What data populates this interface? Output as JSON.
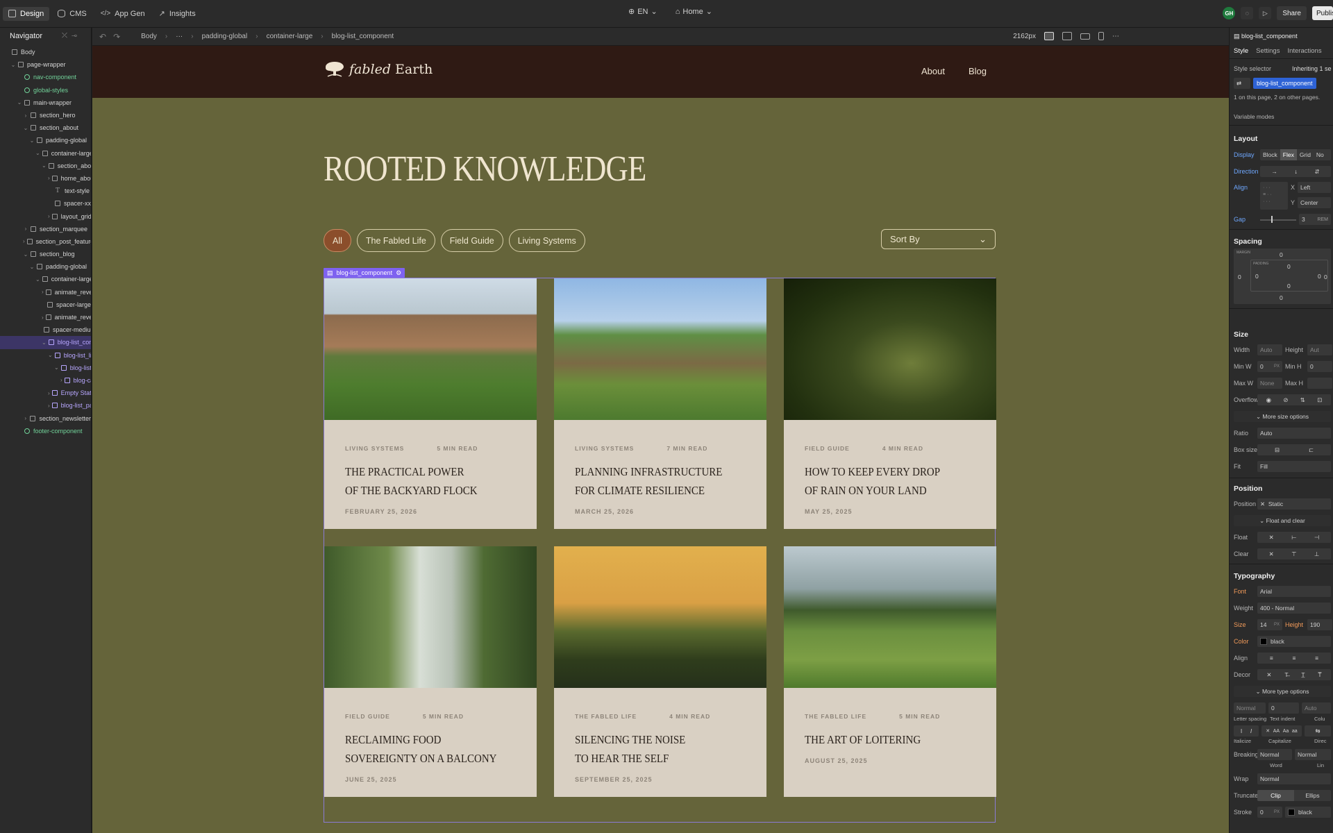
{
  "topbar": {
    "tabs": [
      {
        "label": "Design",
        "icon": "cursor-icon"
      },
      {
        "label": "CMS",
        "icon": "database-icon"
      },
      {
        "label": "App Gen",
        "icon": "code-icon"
      },
      {
        "label": "Insights",
        "icon": "chart-icon"
      }
    ],
    "locale": "EN",
    "page": "Home",
    "avatar": "GH",
    "share": "Share",
    "publish": "Publish"
  },
  "navigator": {
    "title": "Navigator",
    "nodes": [
      {
        "label": "Body",
        "depth": 0,
        "kind": "body",
        "caret": ""
      },
      {
        "label": "page-wrapper",
        "depth": 1,
        "kind": "box",
        "caret": "v"
      },
      {
        "label": "nav-component",
        "depth": 2,
        "kind": "component",
        "caret": ""
      },
      {
        "label": "global-styles",
        "depth": 2,
        "kind": "component",
        "caret": ""
      },
      {
        "label": "main-wrapper",
        "depth": 2,
        "kind": "box",
        "caret": "v"
      },
      {
        "label": "section_hero",
        "depth": 3,
        "kind": "box",
        "caret": ">"
      },
      {
        "label": "section_about",
        "depth": 3,
        "kind": "box",
        "caret": "v"
      },
      {
        "label": "padding-global",
        "depth": 4,
        "kind": "box",
        "caret": "v"
      },
      {
        "label": "container-large",
        "depth": 5,
        "kind": "box",
        "caret": "v"
      },
      {
        "label": "section_about",
        "depth": 6,
        "kind": "box",
        "caret": "v"
      },
      {
        "label": "home_about",
        "depth": 7,
        "kind": "box",
        "caret": ">"
      },
      {
        "label": "text-style",
        "depth": 7,
        "kind": "text",
        "caret": ""
      },
      {
        "label": "spacer-xx",
        "depth": 7,
        "kind": "box",
        "caret": ""
      },
      {
        "label": "layout_grid",
        "depth": 7,
        "kind": "box",
        "caret": ">"
      },
      {
        "label": "section_marquee",
        "depth": 3,
        "kind": "box",
        "caret": ">"
      },
      {
        "label": "section_post_featured",
        "depth": 3,
        "kind": "box",
        "caret": ">"
      },
      {
        "label": "section_blog",
        "depth": 3,
        "kind": "box",
        "caret": "v"
      },
      {
        "label": "padding-global",
        "depth": 4,
        "kind": "box",
        "caret": "v"
      },
      {
        "label": "container-large",
        "depth": 5,
        "kind": "box",
        "caret": "v"
      },
      {
        "label": "animate_reveal",
        "depth": 6,
        "kind": "box",
        "caret": ">"
      },
      {
        "label": "spacer-large",
        "depth": 6,
        "kind": "box",
        "caret": ""
      },
      {
        "label": "animate_reveal",
        "depth": 6,
        "kind": "box",
        "caret": ">"
      },
      {
        "label": "spacer-medium",
        "depth": 6,
        "kind": "box",
        "caret": ""
      },
      {
        "label": "blog-list_component",
        "depth": 6,
        "kind": "cms",
        "caret": "v",
        "selected": true
      },
      {
        "label": "blog-list_list",
        "depth": 7,
        "kind": "cms",
        "caret": "v"
      },
      {
        "label": "blog-list_item",
        "depth": 8,
        "kind": "cms",
        "caret": "v"
      },
      {
        "label": "blog-card",
        "depth": 9,
        "kind": "cms",
        "caret": ">"
      },
      {
        "label": "Empty State",
        "depth": 7,
        "kind": "cms",
        "caret": ">"
      },
      {
        "label": "blog-list_pagination",
        "depth": 7,
        "kind": "cms",
        "caret": ">"
      },
      {
        "label": "section_newsletter",
        "depth": 3,
        "kind": "box",
        "caret": ">"
      },
      {
        "label": "footer-component",
        "depth": 2,
        "kind": "component",
        "caret": ""
      }
    ]
  },
  "breadcrumb": [
    "Body",
    "···",
    "padding-global",
    "container-large",
    "blog-list_component"
  ],
  "breakpoint": "2162px",
  "site": {
    "brand": "fabled Earth",
    "brand_italic": "fabled",
    "brand_rest": " Earth",
    "nav_links": [
      "About",
      "Blog"
    ],
    "hero_title": "ROOTED KNOWLEDGE",
    "filters": [
      "All",
      "The Fabled Life",
      "Field Guide",
      "Living Systems"
    ],
    "sort_label": "Sort By",
    "selected_label": "blog-list_component",
    "posts": [
      {
        "category": "LIVING SYSTEMS",
        "read": "5 MIN READ",
        "title_lines": [
          "THE PRACTICAL POWER",
          "OF THE BACKYARD FLOCK"
        ],
        "date": "FEBRUARY 25, 2026",
        "image": "farmhouse-chickens-photo"
      },
      {
        "category": "LIVING SYSTEMS",
        "read": "7 MIN READ",
        "title_lines": [
          "PLANNING INFRASTRUCTURE",
          "FOR CLIMATE RESILIENCE"
        ],
        "date": "MARCH 25, 2026",
        "image": "earth-sheltered-house-photo"
      },
      {
        "category": "FIELD GUIDE",
        "read": "4 MIN READ",
        "title_lines": [
          "HOW TO KEEP EVERY DROP",
          "OF RAIN ON YOUR LAND"
        ],
        "date": "MAY 25, 2025",
        "image": "water-droplet-ripples-photo"
      },
      {
        "category": "FIELD GUIDE",
        "read": "5 MIN READ",
        "title_lines": [
          "RECLAIMING FOOD",
          "SOVEREIGNTY ON A BALCONY"
        ],
        "date": "JUNE 25, 2025",
        "image": "balcony-garden-photo"
      },
      {
        "category": "THE FABLED LIFE",
        "read": "4 MIN READ",
        "title_lines": [
          "SILENCING THE NOISE",
          "TO HEAR THE SELF"
        ],
        "date": "SEPTEMBER 25, 2025",
        "image": "foggy-sunset-trees-photo"
      },
      {
        "category": "THE FABLED LIFE",
        "read": "5 MIN READ",
        "title_lines": [
          "THE ART OF LOITERING"
        ],
        "date": "AUGUST 25, 2025",
        "image": "green-meadow-photo"
      }
    ]
  },
  "style_panel": {
    "element": "blog-list_component",
    "tabs": [
      "Style",
      "Settings",
      "Interactions"
    ],
    "style_selector": "Style selector",
    "inheriting": "Inheriting 1 se",
    "selector_chip": "blog-list_component",
    "page_note": "1 on this page, 2 on other pages.",
    "variable_modes": "Variable modes",
    "layout": {
      "heading": "Layout",
      "display_label": "Display",
      "display_options": [
        "Block",
        "Flex",
        "Grid",
        "No"
      ],
      "display_value": "Flex",
      "direction_label": "Direction",
      "align_label": "Align",
      "align_x": "Left",
      "align_y": "Center",
      "gap_label": "Gap",
      "gap_value": "3",
      "gap_unit": "REM"
    },
    "spacing": {
      "heading": "Spacing",
      "margin_label": "MARGIN",
      "padding_label": "PADDING",
      "values": [
        "0",
        "0",
        "0",
        "0",
        "0",
        "0",
        "0",
        "0"
      ]
    },
    "size": {
      "heading": "Size",
      "width_label": "Width",
      "width": "Auto",
      "height_label": "Height",
      "height": "Aut",
      "minw_label": "Min W",
      "minw": "0",
      "minh_label": "Min H",
      "minh": "0",
      "maxw_label": "Max W",
      "maxw": "None",
      "maxh_label": "Max H",
      "maxh": "",
      "overflow_label": "Overflow",
      "more": "More size options",
      "ratio_label": "Ratio",
      "ratio": "Auto",
      "boxsize_label": "Box size",
      "fit_label": "Fit",
      "fit": "Fill",
      "px": "PX"
    },
    "position": {
      "heading": "Position",
      "label": "Position",
      "value": "Static",
      "float_clear": "Float and clear",
      "float_label": "Float",
      "clear_label": "Clear"
    },
    "typography": {
      "heading": "Typography",
      "font_label": "Font",
      "font": "Arial",
      "weight_label": "Weight",
      "weight": "400 - Normal",
      "size_label": "Size",
      "size": "14",
      "size_unit": "PX",
      "height_label": "Height",
      "height": "190",
      "color_label": "Color",
      "color": "black",
      "align_label": "Align",
      "decor_label": "Decor",
      "more": "More type options",
      "letter_spacing_value": "Normal",
      "text_indent_value": "0",
      "columns_value": "Auto",
      "letter_spacing": "Letter spacing",
      "text_indent": "Text indent",
      "columns": "Colu",
      "italicize": "Italicize",
      "capitalize": "Capitalize",
      "direction": "Direc",
      "breaking_label": "Breaking",
      "breaking": "Normal",
      "breaking2": "Normal",
      "word": "Word",
      "line": "Lin",
      "wrap_label": "Wrap",
      "wrap": "Normal",
      "truncate_label": "Truncate",
      "truncate_clip": "Clip",
      "truncate_ellipsis": "Ellips",
      "stroke_label": "Stroke",
      "stroke_value": "0",
      "stroke_unit": "PX",
      "stroke_color": "black"
    }
  },
  "colors": {
    "canvas_bg": "#65643a",
    "site_nav_bg": "#2f1a14",
    "card_bg": "#d9d0c3",
    "active_pill": "#8b4e2b",
    "selection": "#7e62f0",
    "component_green": "#72d39a"
  }
}
